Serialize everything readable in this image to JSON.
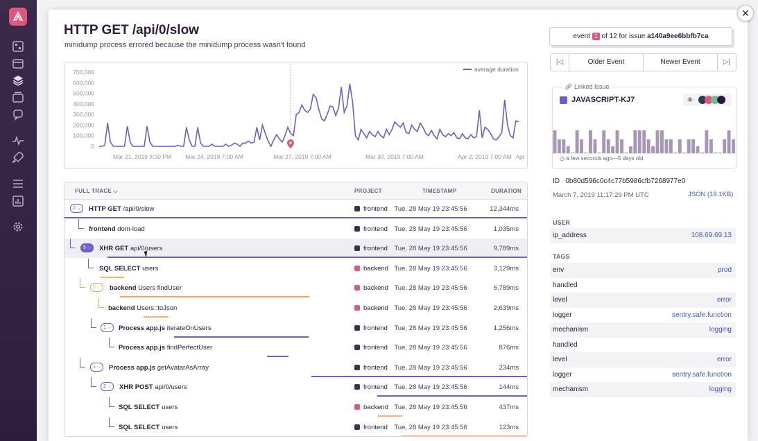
{
  "header": {
    "title": "HTTP GET /api/0/slow",
    "subtitle": "minidump process errored because the minidump process wasn't found"
  },
  "chart_data": {
    "type": "line",
    "legend": "average duration",
    "legend_position": "top-right",
    "ylim": [
      0,
      700000
    ],
    "y_ticks": [
      "700,000",
      "600,000",
      "500,000",
      "400,000",
      "300,000",
      "200,000",
      "100,000",
      "0"
    ],
    "x_ticks": [
      "Mar 21, 2019 8:30 PM",
      "Mar 24, 2019 7:00 AM",
      "Mar 27, 2019 7:00 AM",
      "Mar 30, 2019 7:00 AM",
      "Apr 2, 2019 7:00 AM",
      "Apr"
    ],
    "series": [
      {
        "name": "average duration",
        "values": [
          0,
          0,
          10000,
          220000,
          40000,
          0,
          0,
          0,
          0,
          0,
          190000,
          40000,
          0,
          0,
          0,
          0,
          0,
          190000,
          40000,
          0,
          0,
          0,
          0,
          0,
          0,
          0,
          0,
          0,
          10000,
          0,
          0,
          180000,
          60000,
          0,
          0,
          180000,
          30000,
          0,
          0,
          0,
          20000,
          0,
          0,
          0,
          0,
          20000,
          0,
          10000,
          30000,
          20000,
          0,
          30000,
          30000,
          50000,
          30000,
          40000,
          180000,
          60000,
          200000,
          120000,
          50000,
          0,
          60000,
          110000,
          70000,
          40000,
          100000,
          180000,
          120000,
          100000,
          300000,
          320000,
          390000,
          340000,
          320000,
          350000,
          490000,
          460000,
          350000,
          260000,
          240000,
          300000,
          380000,
          370000,
          290000,
          360000,
          560000,
          320000,
          380000,
          590000,
          420000,
          100000,
          60000,
          160000,
          120000,
          80000,
          140000,
          110000,
          90000,
          140000,
          100000,
          80000,
          160000,
          110000,
          160000,
          230000,
          200000,
          180000,
          220000,
          130000,
          120000,
          200000,
          160000,
          140000,
          220000,
          180000,
          120000,
          100000,
          150000,
          100000,
          70000,
          160000,
          110000,
          90000,
          120000,
          100000,
          130000,
          80000,
          70000,
          120000,
          80000,
          70000,
          110000,
          80000,
          90000,
          340000,
          80000,
          180000,
          160000,
          120000,
          70000,
          60000,
          90000,
          130000,
          440000,
          200000,
          100000,
          80000,
          240000,
          230000
        ]
      }
    ],
    "marker_label": "event"
  },
  "trace": {
    "headers": {
      "name": "FULL TRACE",
      "project": "PROJECT",
      "timestamp": "TIMESTAMP",
      "duration": "DURATION"
    },
    "rows": [
      {
        "count": "2",
        "op": "HTTP GET",
        "desc": "/api/0/slow",
        "project": "frontend",
        "timestamp": "Tue, 28 May 19 23:45:56",
        "duration": "12,344ms"
      },
      {
        "count": "",
        "op": "frontend",
        "desc": "dom-load",
        "project": "frontend",
        "timestamp": "Tue, 28 May 19 23:45:56",
        "duration": "1,035ms"
      },
      {
        "count": "5",
        "op": "XHR GET",
        "desc": "api/0/users",
        "project": "frontend",
        "timestamp": "Tue, 28 May 19 23:45:56",
        "duration": "9,789ms"
      },
      {
        "count": "",
        "op": "SQL SELECT",
        "desc": "users",
        "project": "backend",
        "timestamp": "Tue, 28 May 19 23:45:56",
        "duration": "3,129ms"
      },
      {
        "count": "2",
        "op": "backend",
        "desc": "Users findUser",
        "project": "backend",
        "timestamp": "Tue, 28 May 19 23:45:56",
        "duration": "6,789ms"
      },
      {
        "count": "",
        "op": "backend",
        "desc": "Users::toJson",
        "project": "backend",
        "timestamp": "Tue, 28 May 19 23:45:56",
        "duration": "2,639ms"
      },
      {
        "count": "1",
        "op": "Process app.js",
        "desc": "iterateOnUsers",
        "project": "frontend",
        "timestamp": "Tue, 28 May 19 23:45:56",
        "duration": "1,256ms"
      },
      {
        "count": "",
        "op": "Process app.js",
        "desc": "findPerfectUser",
        "project": "frontend",
        "timestamp": "Tue, 28 May 19 23:45:56",
        "duration": "876ms"
      },
      {
        "count": "1",
        "op": "Process app.js",
        "desc": "getAvatarAsArray",
        "project": "frontend",
        "timestamp": "Tue, 28 May 19 23:45:56",
        "duration": "234ms"
      },
      {
        "count": "2",
        "op": "XHR POST",
        "desc": "api/0/users",
        "project": "frontend",
        "timestamp": "Tue, 28 May 19 23:45:56",
        "duration": "144ms"
      },
      {
        "count": "",
        "op": "SQL SELECT",
        "desc": "users",
        "project": "backend",
        "timestamp": "Tue, 28 May 19 23:45:56",
        "duration": "437ms"
      },
      {
        "count": "",
        "op": "SQL SELECT",
        "desc": "users",
        "project": "frontend",
        "timestamp": "Tue, 28 May 19 23:45:56",
        "duration": "123ms"
      }
    ]
  },
  "event_nav": {
    "prefix": "event",
    "index": "1",
    "middle": "of 12 for issue",
    "issue_id": "a140a9ee6bbfb7ca",
    "older": "Older Event",
    "newer": "Newer Event"
  },
  "linked_issue": {
    "label": "Linked Issue",
    "short_id": "JAVASCRIPT-KJ7",
    "footer": "a few seconds ago—5 days old"
  },
  "event_meta": {
    "id_label": "ID",
    "id": "0b80d596c0c4c77b5986cfb7268977e0",
    "date": "March 7, 2019 11:17:29 PM UTC",
    "json_link": "JSON (19.1KB)"
  },
  "user": {
    "heading": "USER",
    "key": "ip_address",
    "value": "108.69.69.13"
  },
  "tags": {
    "heading": "TAGS",
    "items": [
      {
        "key": "env",
        "value": "prod"
      },
      {
        "key": "handled",
        "value": ""
      },
      {
        "key": "level",
        "value": "error"
      },
      {
        "key": "logger",
        "value": "sentry.safe.function"
      },
      {
        "key": "mechanism",
        "value": "logging"
      },
      {
        "key": "handled",
        "value": ""
      },
      {
        "key": "level",
        "value": "error"
      },
      {
        "key": "logger",
        "value": "sentry.safe.function"
      },
      {
        "key": "mechanism",
        "value": "logging"
      }
    ]
  },
  "colors": {
    "accent": "#6c5fc7",
    "frontend": "#2b3a4f",
    "backend": "#e1567c",
    "orange": "#f5a55a",
    "link": "#3e58c8"
  }
}
